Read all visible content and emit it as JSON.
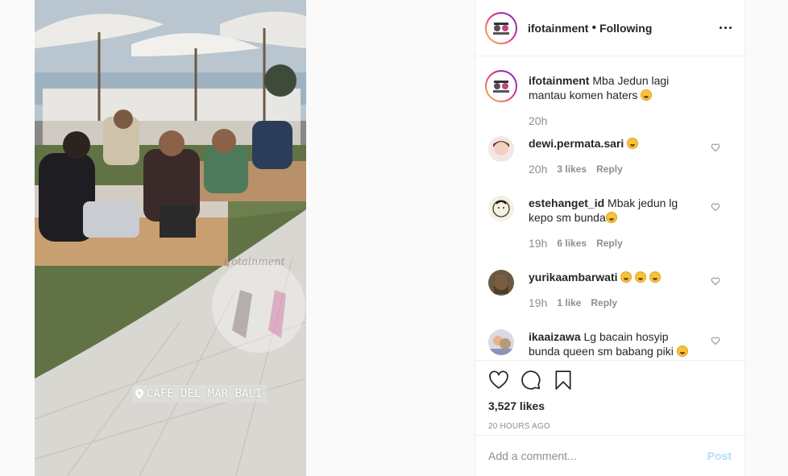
{
  "media": {
    "location_label": "CAFÉ DEL MAR BALI",
    "watermark": "ifotainment",
    "icon": "location-pin-icon"
  },
  "header": {
    "username": "ifotainment",
    "separator": "•",
    "follow_status": "Following",
    "more_icon": "more-options-icon"
  },
  "caption": {
    "username": "ifotainment",
    "text": "Mba Jedun lagi mantau komen haters",
    "emoji": "rolling-laughing-emoji",
    "time": "20h"
  },
  "comments": [
    {
      "username": "dewi.permata.sari",
      "text": "",
      "emoji_count": 1,
      "time": "20h",
      "likes": "3 likes",
      "reply": "Reply"
    },
    {
      "username": "estehanget_id",
      "text": "Mbak jedun lg kepo sm bunda",
      "emoji_count": 1,
      "time": "19h",
      "likes": "6 likes",
      "reply": "Reply"
    },
    {
      "username": "yurikaambarwati",
      "text": "",
      "emoji_count": 3,
      "time": "19h",
      "likes": "1 like",
      "reply": "Reply"
    },
    {
      "username": "ikaaizawa",
      "text": "Lg bacain hosyip bunda queen sm babang piki",
      "emoji_count": 1,
      "time": "",
      "likes": "",
      "reply": ""
    }
  ],
  "actions": {
    "like_icon": "heart-icon",
    "comment_icon": "comment-bubble-icon",
    "save_icon": "bookmark-icon",
    "likes_count": "3,527 likes",
    "timestamp": "20 HOURS AGO"
  },
  "add_comment": {
    "placeholder": "Add a comment...",
    "post_label": "Post"
  },
  "colors": {
    "link_disabled": "#b2dffc",
    "muted": "#8e8e8e",
    "text": "#262626"
  }
}
